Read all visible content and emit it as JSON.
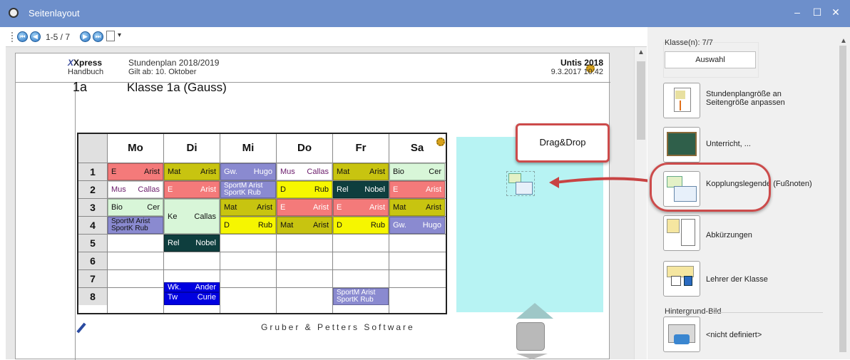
{
  "window": {
    "title": "Seitenlayout",
    "minimize": "–",
    "maximize": "☐",
    "close": "✕"
  },
  "toolbar": {
    "page_info": "1-5 / 7",
    "dropdown_arrow": "▾"
  },
  "page_header": {
    "logo_text": "Xpress",
    "handbuch": "Handbuch",
    "plan_title": "Stundenplan 2018/2019",
    "gilt_ab": "Gilt ab: 10. Oktober",
    "software": "Untis 2018",
    "date": "9.3.2017 10:42"
  },
  "class": {
    "code": "1a",
    "name": "Klasse 1a (Gauss)"
  },
  "timetable": {
    "days": [
      "Mo",
      "Di",
      "Mi",
      "Do",
      "Fr",
      "Sa"
    ],
    "hours": [
      "1",
      "2",
      "3",
      "4",
      "5",
      "6",
      "7",
      "8"
    ],
    "cells": [
      {
        "id": "c1",
        "a": "E",
        "b": "Arist",
        "color": "#f47a7a",
        "tc": "#111"
      },
      {
        "id": "c2",
        "a": "Mat",
        "b": "Arist",
        "color": "#c8c410",
        "tc": "#111"
      },
      {
        "id": "c3",
        "a": "Gw.",
        "b": "Hugo",
        "color": "#8a8ad0",
        "tc": "#fff"
      },
      {
        "id": "c4",
        "a": "Mus",
        "b": "Callas",
        "color": "#ffffff",
        "tc": "#6a1a6a"
      },
      {
        "id": "c5",
        "a": "Mat",
        "b": "Arist",
        "color": "#c8c410",
        "tc": "#111"
      },
      {
        "id": "c6",
        "a": "Bio",
        "b": "Cer",
        "color": "#d8f6d8",
        "tc": "#111"
      },
      {
        "id": "c7",
        "a": "Mus",
        "b": "Callas",
        "color": "#ffffff",
        "tc": "#6a1a6a"
      },
      {
        "id": "c8",
        "a": "E",
        "b": "Arist",
        "color": "#f47a7a",
        "tc": "#fff"
      },
      {
        "id": "c9",
        "a": "SportM Arist",
        "b": "SportK Rub",
        "color": "#8a8ad0",
        "tc": "#fff"
      },
      {
        "id": "c10",
        "a": "D",
        "b": "Rub",
        "color": "#f6f600",
        "tc": "#111"
      },
      {
        "id": "c11",
        "a": "Rel",
        "b": "Nobel",
        "color": "#0e3e3e",
        "tc": "#fff"
      },
      {
        "id": "c12",
        "a": "E",
        "b": "Arist",
        "color": "#f47a7a",
        "tc": "#fff"
      },
      {
        "id": "c13",
        "a": "Bio",
        "b": "Cer",
        "color": "#d8f6d8",
        "tc": "#111"
      },
      {
        "id": "c14",
        "a": "Ke",
        "b": "Callas",
        "color": "#d8f6d8",
        "tc": "#111"
      },
      {
        "id": "c15",
        "a": "Mat",
        "b": "Arist",
        "color": "#c8c410",
        "tc": "#111"
      },
      {
        "id": "c16",
        "a": "E",
        "b": "Arist",
        "color": "#f47a7a",
        "tc": "#fff"
      },
      {
        "id": "c17",
        "a": "E",
        "b": "Arist",
        "color": "#f47a7a",
        "tc": "#fff"
      },
      {
        "id": "c18",
        "a": "Mat",
        "b": "Arist",
        "color": "#c8c410",
        "tc": "#111"
      },
      {
        "id": "c19",
        "a": "SportM Arist",
        "b": "SportK Rub",
        "color": "#8a8ad0",
        "tc": "#111"
      },
      {
        "id": "c20",
        "a": "D",
        "b": "Rub",
        "color": "#f6f600",
        "tc": "#111"
      },
      {
        "id": "c21",
        "a": "Mat",
        "b": "Arist",
        "color": "#c8c410",
        "tc": "#111"
      },
      {
        "id": "c22",
        "a": "D",
        "b": "Rub",
        "color": "#f6f600",
        "tc": "#111"
      },
      {
        "id": "c23",
        "a": "Gw.",
        "b": "Hugo",
        "color": "#8a8ad0",
        "tc": "#fff"
      },
      {
        "id": "c24",
        "a": "Rel",
        "b": "Nobel",
        "color": "#0e3e3e",
        "tc": "#fff"
      },
      {
        "id": "c25",
        "a": "Wk.",
        "b": "Ander",
        "color": "#0000e0",
        "tc": "#fff"
      },
      {
        "id": "c26",
        "a": "Tw",
        "b": "Curie",
        "color": "#0000e0",
        "tc": "#fff"
      },
      {
        "id": "c27",
        "a": "SportM Arist",
        "b": "SportK Rub",
        "color": "#8a8ad0",
        "tc": "#fff"
      }
    ]
  },
  "page_footer": {
    "company": "Gruber & Petters Software"
  },
  "drag_drop": {
    "label": "Drag&Drop"
  },
  "right_panel": {
    "class_count": "Klasse(n): 7/7",
    "select_button": "Auswahl",
    "items": [
      {
        "label": "Stundenplangröße an Seitengröße anpassen"
      },
      {
        "label": "Unterricht, ..."
      },
      {
        "label": "Kopplungslegende (Fußnoten)"
      },
      {
        "label": "Abkürzungen"
      },
      {
        "label": "Lehrer der Klasse"
      }
    ],
    "background_group": "Hintergrund-Bild",
    "background_value": "<nicht definiert>"
  },
  "colors": {
    "titlebar": "#6d8fcb",
    "highlight": "#cc4b4b",
    "drop_area": "#b7f3f3"
  }
}
